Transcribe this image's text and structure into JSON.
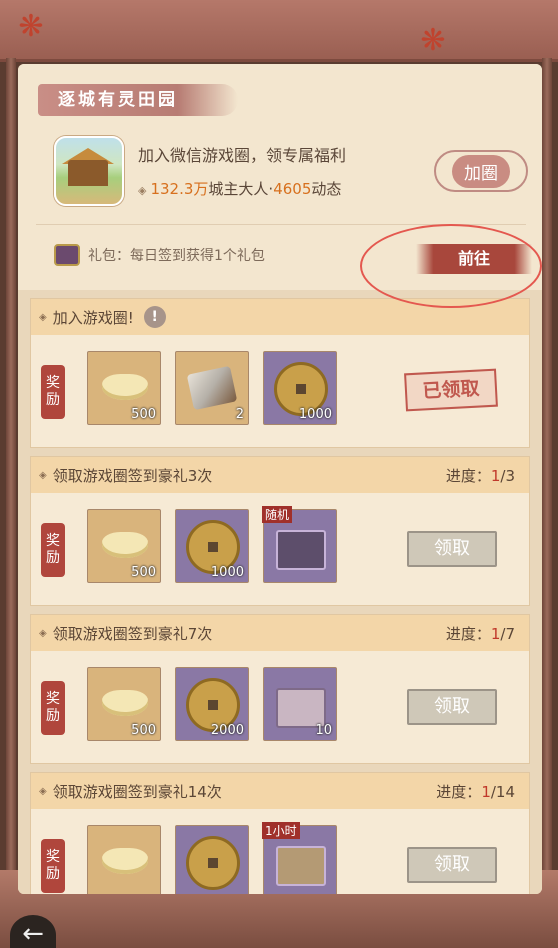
{
  "header": {
    "title": "逐城有灵田园",
    "invite_text": "加入微信游戏圈，领专属福利",
    "stats": {
      "count": "132.3万",
      "count_suffix": "城主大人·",
      "posts": "4605",
      "posts_suffix": "动态"
    },
    "join_label": "加圈",
    "gift_text": "礼包：每日签到获得1个礼包",
    "goto_label": "前往"
  },
  "tasks": [
    {
      "title": "加入游戏圈!",
      "reward_tag": "奖励",
      "items": [
        {
          "icon": "gold-ingot-icon",
          "count": "500"
        },
        {
          "icon": "tools-icon",
          "count": "2"
        },
        {
          "icon": "copper-coin-icon",
          "count": "1000"
        }
      ],
      "status": "已领取"
    },
    {
      "title": "领取游戏圈签到豪礼3次",
      "progress_label": "进度：",
      "progress_cur": "1",
      "progress_total": "/3",
      "reward_tag": "奖励",
      "items": [
        {
          "icon": "gold-ingot-icon",
          "count": "500"
        },
        {
          "icon": "copper-coin-icon",
          "count": "1000"
        },
        {
          "icon": "random-gift-box-icon",
          "badge": "随机"
        }
      ],
      "button": "领取"
    },
    {
      "title": "领取游戏圈签到豪礼7次",
      "progress_label": "进度：",
      "progress_cur": "1",
      "progress_total": "/7",
      "reward_tag": "奖励",
      "items": [
        {
          "icon": "gold-ingot-icon",
          "count": "500"
        },
        {
          "icon": "copper-coin-icon",
          "count": "2000"
        },
        {
          "icon": "letter-icon",
          "count": "10"
        }
      ],
      "button": "领取"
    },
    {
      "title": "领取游戏圈签到豪礼14次",
      "progress_label": "进度：",
      "progress_cur": "1",
      "progress_total": "/14",
      "reward_tag": "奖励",
      "items": [
        {
          "icon": "gold-ingot-icon"
        },
        {
          "icon": "copper-coin-icon"
        },
        {
          "icon": "time-item-icon",
          "badge": "1小时"
        }
      ],
      "button": "领取"
    }
  ],
  "colors": {
    "accent_red": "#a8473c",
    "panel_bg": "#f3e6cf",
    "progress_red": "#c0392b",
    "highlight_ellipse": "#e4584f"
  }
}
